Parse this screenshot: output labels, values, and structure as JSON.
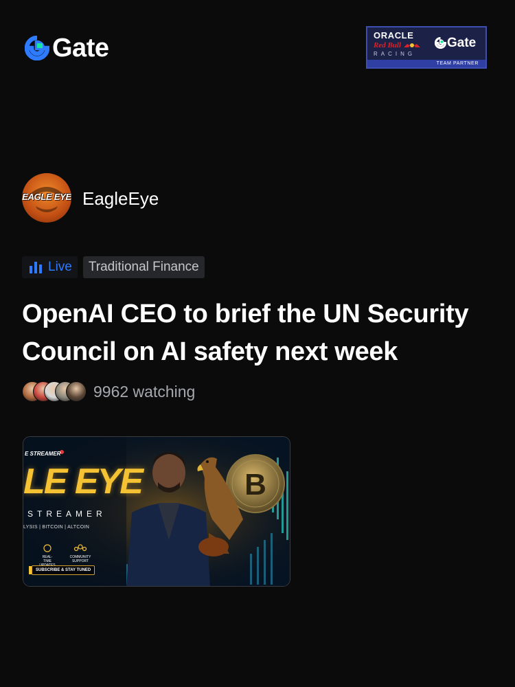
{
  "header": {
    "logo_text": "Gate",
    "logo_icon": "gate-logo-icon",
    "partner": {
      "oracle": "ORACLE",
      "red_bull": "Red Bull",
      "racing": "RACING",
      "gate": "Gate",
      "strip": "TEAM PARTNER"
    }
  },
  "post": {
    "author": {
      "name": "EagleEye",
      "avatar_text": "EAGLE EYE"
    },
    "tags": {
      "live_label": "Live",
      "live_icon": "live-bars-icon",
      "category": "Traditional Finance"
    },
    "headline": "OpenAI CEO to brief the UN Security Council on AI safety next week",
    "watchers": {
      "count_text": "9962 watching",
      "avatar_colors": [
        "#b06a3f",
        "#c9463d",
        "#d8d8d8",
        "#8e8a7e",
        "#5b4636"
      ]
    },
    "thumbnail": {
      "streamer_label": "E STREAMER",
      "title": "LE EYE",
      "subtitle": "STREAMER",
      "topics": "LYSIS  |  BITCOIN  |  ALTCOIN",
      "feature_1": "REAL-TIME UPDATES",
      "feature_2": "COMMUNITY SUPPORT",
      "subscribe": "SUBSCRIBE & STAY TUNED"
    }
  },
  "colors": {
    "background": "#0b0b0c",
    "accent_blue": "#2f7bff",
    "gate_green": "#17e5a0",
    "tag_background": "#25272b",
    "muted_text": "#a6a9ae"
  }
}
